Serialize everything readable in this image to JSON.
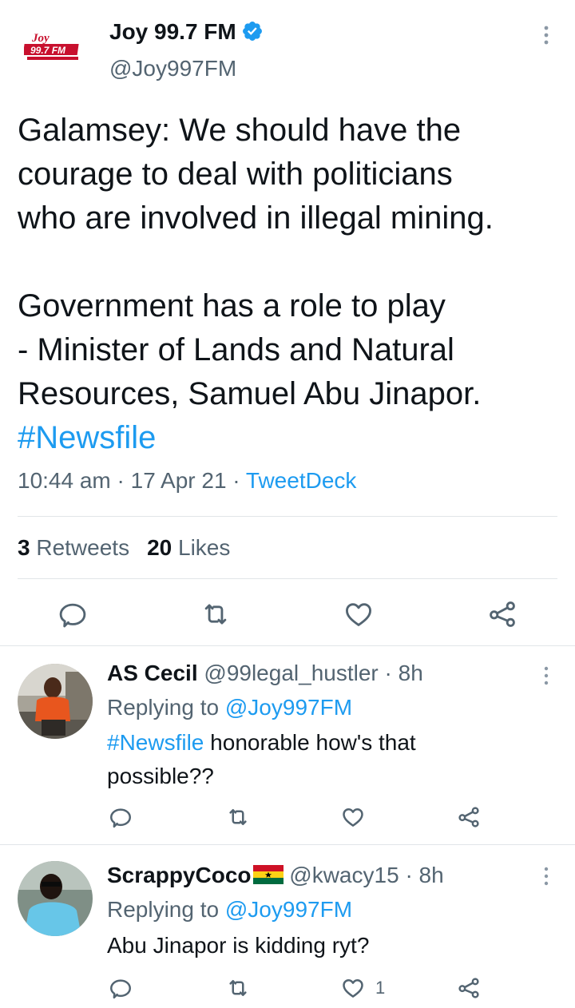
{
  "tweet": {
    "author_name": "Joy 99.7 FM",
    "author_handle": "@Joy997FM",
    "logo_text": "Joy 99.7FM",
    "body_lines_1": [
      "Galamsey: We should have the",
      "courage to deal with politicians",
      "who are involved in illegal mining."
    ],
    "body_lines_2": [
      "Government has a role to play",
      "- Minister of Lands and Natural",
      "Resources, Samuel Abu Jinapor."
    ],
    "hashtag": "#Newsfile",
    "time": "10:44 am",
    "date": "17 Apr 21",
    "separator": "·",
    "source": "TweetDeck",
    "retweets_count": "3",
    "retweets_label": "Retweets",
    "likes_count": "20",
    "likes_label": "Likes"
  },
  "icons": {
    "reply": "speech-bubble-icon",
    "retweet": "retweet-arrows-icon",
    "like": "heart-icon",
    "share": "share-nodes-icon",
    "more": "vertical-ellipsis-icon",
    "verified": "verified-badge-icon"
  },
  "colors": {
    "accent": "#1d9bf0",
    "text": "#0f1419",
    "muted": "#536471",
    "divider": "#e1e5e8"
  },
  "replies": [
    {
      "name": "AS Cecil",
      "handle": "@99legal_hustler",
      "time": "8h",
      "replying_label": "Replying to",
      "replying_to": "@Joy997FM",
      "hashtag": "#Newsfile",
      "text_line_1": "honorable how's that",
      "text_line_2": "possible??"
    },
    {
      "name": "ScrappyCoco",
      "handle": "@kwacy15",
      "time": "8h",
      "replying_label": "Replying to",
      "replying_to": "@Joy997FM",
      "text_line_1": "Abu Jinapor is kidding ryt?",
      "like_count": "1"
    }
  ]
}
